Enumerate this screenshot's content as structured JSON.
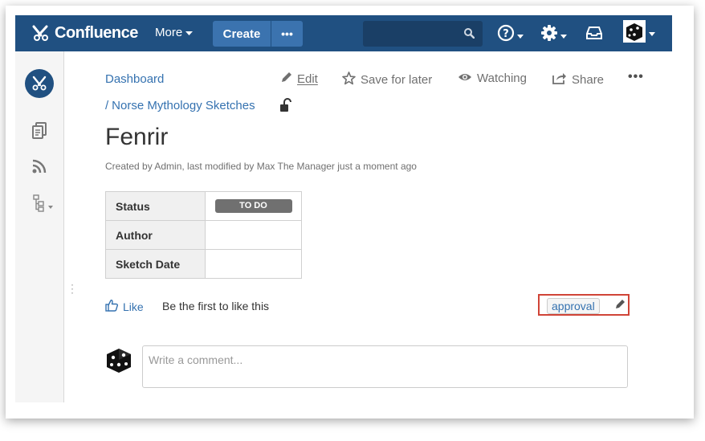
{
  "header": {
    "app_name": "Confluence",
    "more_label": "More",
    "create_label": "Create",
    "create_more_label": "•••",
    "search_placeholder": ""
  },
  "breadcrumbs": [
    {
      "label": "Dashboard"
    },
    {
      "label": "Norse Mythology Sketches"
    }
  ],
  "breadcrumb_separator": "/",
  "actions": {
    "edit": "Edit",
    "save_for_later": "Save for later",
    "watching": "Watching",
    "share": "Share",
    "more": "•••"
  },
  "page": {
    "title": "Fenrir",
    "byline": "Created by Admin, last modified by Max The Manager just a moment ago"
  },
  "properties": [
    {
      "key": "Status",
      "value": "TO DO"
    },
    {
      "key": "Author",
      "value": ""
    },
    {
      "key": "Sketch Date",
      "value": ""
    }
  ],
  "like": {
    "label": "Like",
    "message": "Be the first to like this"
  },
  "labels": [
    "approval"
  ],
  "comment": {
    "placeholder": "Write a comment..."
  },
  "colors": {
    "header": "#205081",
    "create_button": "#3b73af",
    "link": "#3572b0",
    "highlight_border": "#d04437",
    "status_lozenge": "#707070"
  },
  "icons": {
    "logo": "confluence-logo-icon",
    "search": "search-icon",
    "help": "help-icon",
    "settings": "gear-icon",
    "notifications": "inbox-icon",
    "pages": "pages-icon",
    "blog": "rss-icon",
    "tree": "page-tree-icon",
    "lock": "unlock-icon",
    "edit": "pencil-icon",
    "save": "star-icon",
    "watch": "eye-icon",
    "share": "share-icon",
    "like": "thumbs-up-icon",
    "label_edit": "pencil-icon"
  }
}
